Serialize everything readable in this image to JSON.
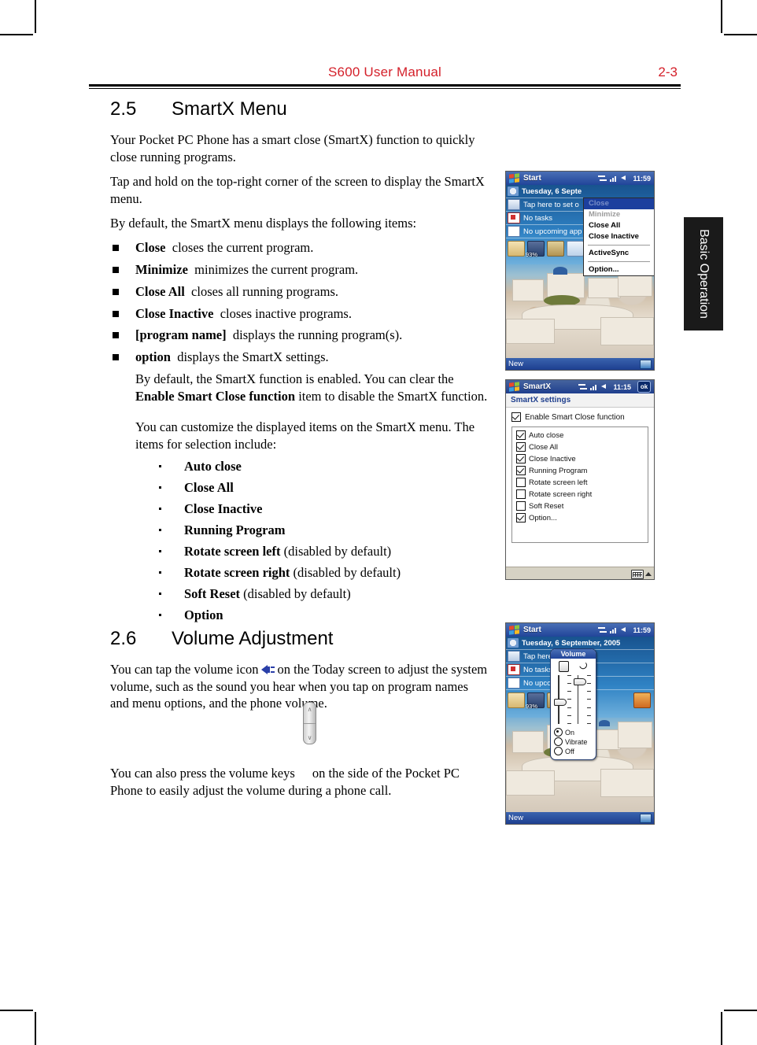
{
  "header": {
    "title": "S600 User Manual",
    "page": "2-3"
  },
  "side_tab": {
    "label": "Basic Operation"
  },
  "sections": {
    "s25": {
      "number": "2.5",
      "title": "SmartX Menu",
      "p1": "Your Pocket PC Phone has a smart close (SmartX) function to quickly close running programs.",
      "p2": "Tap and hold on the top-right corner of the screen to display the SmartX menu.",
      "p3": "By default, the SmartX menu displays the following items:",
      "bullets": [
        {
          "term": "Close",
          "desc": "closes the current program."
        },
        {
          "term": "Minimize",
          "desc": "minimizes the current program."
        },
        {
          "term": "Close All",
          "desc": "closes all running programs."
        },
        {
          "term": "Close Inactive",
          "desc": "closes inactive programs."
        },
        {
          "term": "[program name]",
          "desc": "displays the running program(s)."
        },
        {
          "term": "option",
          "desc": "displays the SmartX settings."
        }
      ],
      "option_para_a": "By default, the SmartX function is enabled. You can clear the ",
      "option_para_b": "Enable Smart Close function",
      "option_para_c": " item to disable the SmartX function.",
      "option_para_2": "You can customize the displayed items on the SmartX menu. The items for selection include:",
      "items": [
        {
          "term": "Auto close",
          "note": ""
        },
        {
          "term": "Close All",
          "note": ""
        },
        {
          "term": "Close Inactive",
          "note": ""
        },
        {
          "term": "Running Program",
          "note": ""
        },
        {
          "term": "Rotate screen left",
          "note": "(disabled by default)"
        },
        {
          "term": "Rotate screen right",
          "note": "(disabled by default)"
        },
        {
          "term": "Soft Reset",
          "note": "(disabled by default)"
        },
        {
          "term": "Option",
          "note": ""
        }
      ]
    },
    "s26": {
      "number": "2.6",
      "title": "Volume Adjustment",
      "p1_a": "You can tap the volume icon",
      "p1_b": "on the Today screen to adjust the system volume, such as the sound you hear when you tap on program names and menu options, and the phone volume.",
      "p2_a": "You can also press the volume keys",
      "p2_b": "on the side of the Pocket PC Phone to easily adjust the volume during a phone call.",
      "key_up": "∧",
      "key_down": "∨"
    }
  },
  "figures": {
    "today_menu": {
      "titlebar": {
        "start": "Start",
        "time": "11:59"
      },
      "rows": [
        {
          "icon": "clock-icon",
          "text": "Tuesday, 6 Septe"
        },
        {
          "icon": "owner-info-icon",
          "text": "Tap here to set o"
        },
        {
          "icon": "tasks-icon",
          "text": "No tasks"
        },
        {
          "icon": "appointments-icon",
          "text": "No upcoming app"
        }
      ],
      "battery": "93%",
      "bottom_left": "New",
      "menu": [
        {
          "label": "Close",
          "state": "selected"
        },
        {
          "label": "Minimize",
          "state": "disabled"
        },
        {
          "label": "Close All",
          "state": "normal"
        },
        {
          "label": "Close Inactive",
          "state": "normal"
        },
        {
          "label": "__sep__",
          "state": "separator"
        },
        {
          "label": "ActiveSync",
          "state": "normal"
        },
        {
          "label": "__sep__",
          "state": "separator"
        },
        {
          "label": "Option...",
          "state": "normal"
        }
      ]
    },
    "smartx_settings": {
      "titlebar": {
        "app": "SmartX",
        "time": "11:15",
        "ok": "ok"
      },
      "subtitle": "SmartX settings",
      "enable": {
        "label": "Enable Smart Close function",
        "checked": true
      },
      "options": [
        {
          "label": "Auto close",
          "checked": true
        },
        {
          "label": "Close All",
          "checked": true
        },
        {
          "label": "Close Inactive",
          "checked": true
        },
        {
          "label": "Running Program",
          "checked": true
        },
        {
          "label": "Rotate screen left",
          "checked": false
        },
        {
          "label": "Rotate screen right",
          "checked": false
        },
        {
          "label": "Soft Reset",
          "checked": false
        },
        {
          "label": "Option...",
          "checked": true
        }
      ]
    },
    "volume_popup": {
      "titlebar": {
        "start": "Start",
        "time": "11:59"
      },
      "rows": [
        {
          "icon": "clock-icon",
          "text": "Tuesday, 6 September, 2005"
        },
        {
          "icon": "owner-info-icon",
          "text": "Tap here to set       ation"
        },
        {
          "icon": "tasks-icon",
          "text": "No tasks"
        },
        {
          "icon": "appointments-icon",
          "text": "No upcoming app"
        }
      ],
      "battery": "93%",
      "bottom_left": "New",
      "popup_title": "Volume",
      "radios": [
        {
          "label": "On",
          "selected": true
        },
        {
          "label": "Vibrate",
          "selected": false
        },
        {
          "label": "Off",
          "selected": false
        }
      ]
    }
  },
  "colors": {
    "header_red": "#d4202a",
    "tab_black": "#1a1a1a",
    "ppc_title_blue": "#21459a",
    "menu_select_blue": "#1c3f9e"
  }
}
